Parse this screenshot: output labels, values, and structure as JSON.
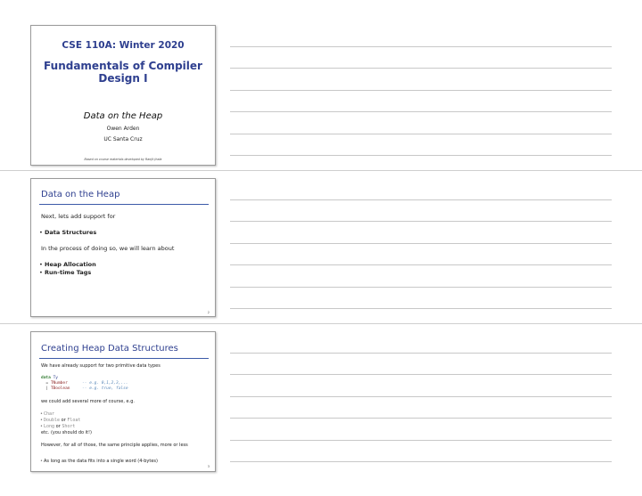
{
  "slide1": {
    "course": "CSE 110A: Winter 2020",
    "title": "Fundamentals of Compiler Design I",
    "subtitle": "Data on the Heap",
    "author": "Owen Arden",
    "school": "UC Santa Cruz",
    "credit": "Based on course materials developed by Ranjit Jhala"
  },
  "slide2": {
    "title": "Data on the Heap",
    "intro": "Next, lets add support for",
    "bullets1": [
      "Data Structures"
    ],
    "middle": "In the process of doing so, we will learn about",
    "bullets2": [
      "Heap Allocation",
      "Run-time Tags"
    ],
    "page": "2"
  },
  "slide3": {
    "title": "Creating Heap Data Structures",
    "intro": "We have already support for two primitive data types",
    "code": {
      "kw": "data",
      "ty": "Ty",
      "l1_sep": "= ",
      "l1_ctor": "TNumber",
      "l1_comment": "-- e.g. 0,1,2,3,...",
      "l2_sep": "| ",
      "l2_ctor": "TBoolean",
      "l2_comment": "-- e.g. true, false"
    },
    "more": "we could add several more of course, e.g.",
    "types": {
      "t1": "Char",
      "t2a": "Double",
      "or": "or",
      "t2b": "Float",
      "t3a": "Long",
      "t3b": "Short"
    },
    "etc": "etc. (you should do it!)",
    "however": "However, for all of those, the same principle applies, more or less",
    "bullet": "As long as the data fits into a single word (4-bytes)",
    "page": "3"
  }
}
